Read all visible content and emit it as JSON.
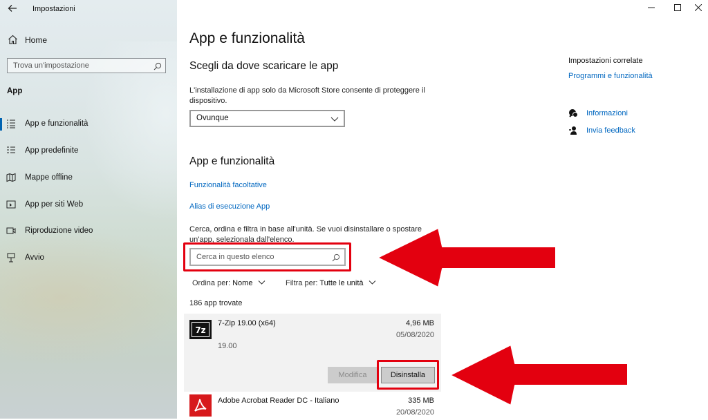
{
  "window": {
    "title": "Impostazioni"
  },
  "sidebar": {
    "home_label": "Home",
    "search_placeholder": "Trova un'impostazione",
    "section_label": "App",
    "items": [
      {
        "label": "App e funzionalità",
        "icon": "apps-list-icon",
        "active": true
      },
      {
        "label": "App predefinite",
        "icon": "default-apps-icon"
      },
      {
        "label": "Mappe offline",
        "icon": "map-icon"
      },
      {
        "label": "App per siti Web",
        "icon": "web-app-icon"
      },
      {
        "label": "Riproduzione video",
        "icon": "video-icon"
      },
      {
        "label": "Avvio",
        "icon": "startup-icon"
      }
    ]
  },
  "main": {
    "title": "App e funzionalità",
    "download_heading": "Scegli da dove scaricare le app",
    "download_desc": "L'installazione di app solo da Microsoft Store consente di proteggere il dispositivo.",
    "download_source": "Ovunque",
    "apps_heading": "App e funzionalità",
    "link_optional": "Funzionalità facoltative",
    "link_alias": "Alias di esecuzione App",
    "search_desc": "Cerca, ordina e filtra in base all'unità. Se vuoi disinstallare o spostare un'app, selezionala dall'elenco.",
    "search_placeholder": "Cerca in questo elenco",
    "sort_label": "Ordina per:",
    "sort_value": "Nome",
    "filter_label": "Filtra per:",
    "filter_value": "Tutte le unità",
    "count_text": "186 app trovate",
    "apps": [
      {
        "name": "7-Zip 19.00 (x64)",
        "size": "4,96 MB",
        "date": "05/08/2020",
        "version": "19.00",
        "icon": "7zip-icon"
      },
      {
        "name": "Adobe Acrobat Reader DC - Italiano",
        "size": "335 MB",
        "date": "20/08/2020",
        "icon": "acrobat-icon"
      }
    ],
    "modify_label": "Modifica",
    "uninstall_label": "Disinstalla"
  },
  "related": {
    "title": "Impostazioni correlate",
    "programs_link": "Programmi e funzionalità",
    "info_link": "Informazioni",
    "feedback_link": "Invia feedback"
  },
  "colors": {
    "accent": "#0067c0",
    "highlight": "#e3000f"
  }
}
